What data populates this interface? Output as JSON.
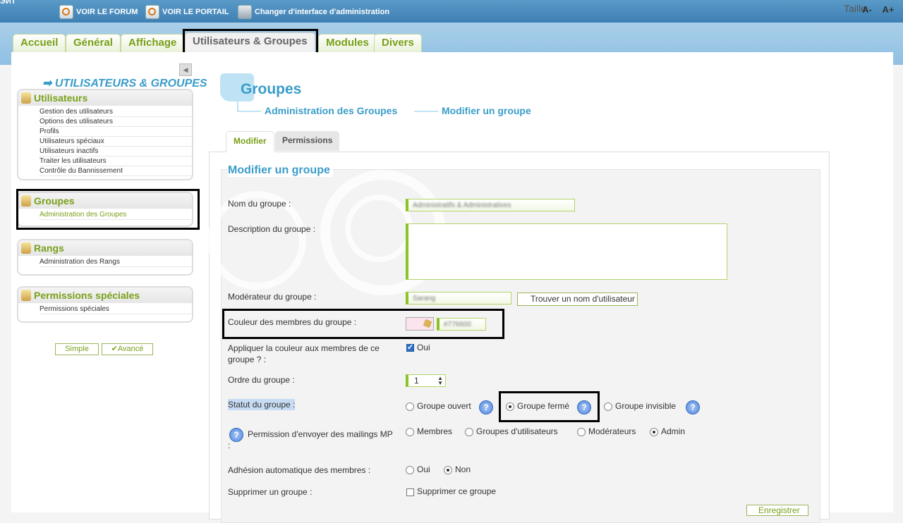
{
  "topbar": {
    "logo": "ЭИТ",
    "links": [
      "VOIR LE FORUM",
      "VOIR LE PORTAIL",
      "Changer d'interface d'administration"
    ],
    "size_label": "Taille",
    "size_minus": "A-",
    "size_plus": "A+"
  },
  "tabs": [
    "Accueil",
    "Général",
    "Affichage",
    "Utilisateurs & Groupes",
    "Modules",
    "Divers"
  ],
  "active_tab": "Utilisateurs & Groupes",
  "sidebar": {
    "title": "UTILISATEURS & GROUPES",
    "sections": [
      {
        "title": "Utilisateurs",
        "items": [
          "Gestion des utilisateurs",
          "Options des utilisateurs",
          "Profils",
          "Utilisateurs spéciaux",
          "Utilisateurs inactifs",
          "Traiter les utilisateurs",
          "Contrôle du Bannissement"
        ]
      },
      {
        "title": "Groupes",
        "items": [
          "Administration des Groupes"
        ]
      },
      {
        "title": "Rangs",
        "items": [
          "Administration des Rangs"
        ]
      },
      {
        "title": "Permissions spéciales",
        "items": [
          "Permissions spéciales"
        ]
      }
    ],
    "btn_simple": "Simple",
    "btn_avance": "Avancé"
  },
  "page": {
    "title": "Groupes",
    "breadcrumb": [
      "Administration des Groupes",
      "Modifier un groupe"
    ],
    "tabs": [
      "Modifier",
      "Permissions"
    ]
  },
  "form": {
    "title": "Modifier un groupe",
    "name_label": "Nom du groupe :",
    "name_value": "Administratifs & Administratives",
    "desc_label": "Description du groupe :",
    "mod_label": "Modérateur du groupe :",
    "mod_value": "Sarang",
    "find_user": "Trouver un nom d'utilisateur",
    "color_label": "Couleur des membres du groupe :",
    "color_value": "#776600",
    "apply_color_label": "Appliquer la couleur aux membres de ce groupe ? :",
    "apply_color_option": "Oui",
    "order_label": "Ordre du groupe :",
    "order_value": "1",
    "status_label": "Statut du groupe :",
    "status_options": [
      "Groupe ouvert",
      "Groupe fermé",
      "Groupe invisible"
    ],
    "mailing_label": "Permission d'envoyer des mailings MP :",
    "mailing_options": [
      "Membres",
      "Groupes d'utilisateurs",
      "Modérateurs",
      "Admin"
    ],
    "auto_label": "Adhésion automatique des membres :",
    "auto_options": [
      "Oui",
      "Non"
    ],
    "delete_label": "Supprimer un groupe :",
    "delete_option": "Supprimer ce groupe",
    "save": "Enregistrer"
  },
  "colors": {
    "accent_green": "#79a01a",
    "accent_blue": "#3a9dc9",
    "topbar": "#4a8bbd"
  }
}
